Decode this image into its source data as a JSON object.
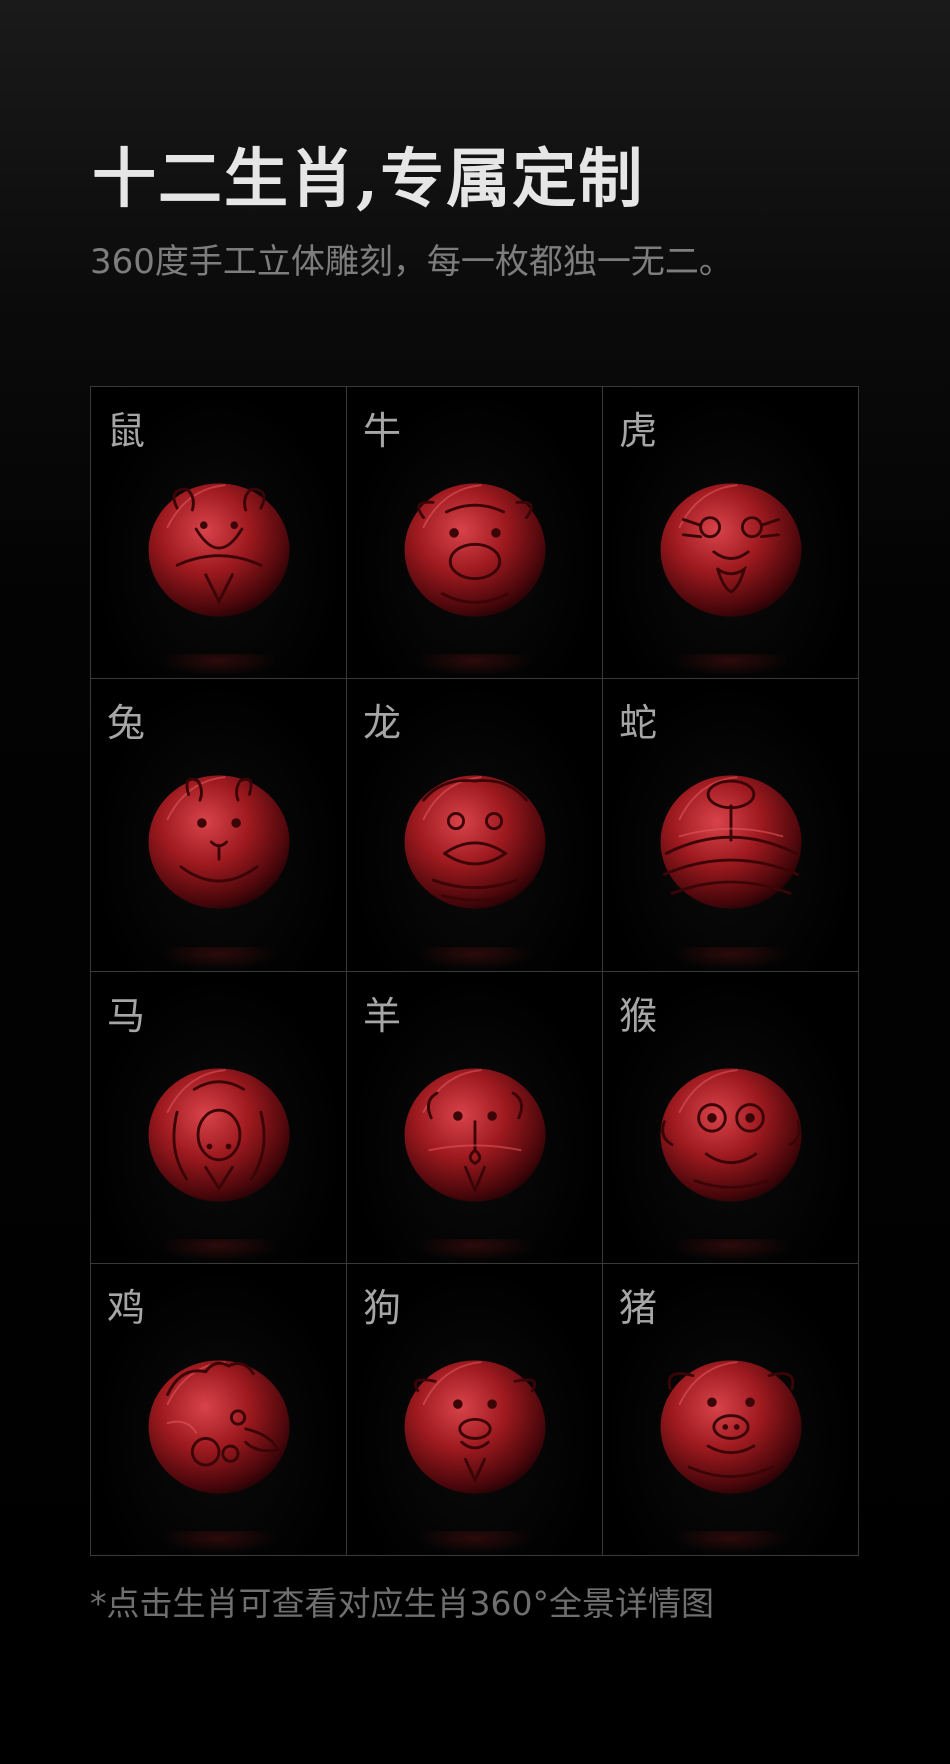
{
  "header": {
    "title": "十二生肖,专属定制",
    "subtitle": "360度手工立体雕刻，每一枚都独一无二。"
  },
  "zodiac": [
    {
      "label": "鼠",
      "icon": "rat-bead-icon"
    },
    {
      "label": "牛",
      "icon": "ox-bead-icon"
    },
    {
      "label": "虎",
      "icon": "tiger-bead-icon"
    },
    {
      "label": "兔",
      "icon": "rabbit-bead-icon"
    },
    {
      "label": "龙",
      "icon": "dragon-bead-icon"
    },
    {
      "label": "蛇",
      "icon": "snake-bead-icon"
    },
    {
      "label": "马",
      "icon": "horse-bead-icon"
    },
    {
      "label": "羊",
      "icon": "goat-bead-icon"
    },
    {
      "label": "猴",
      "icon": "monkey-bead-icon"
    },
    {
      "label": "鸡",
      "icon": "rooster-bead-icon"
    },
    {
      "label": "狗",
      "icon": "dog-bead-icon"
    },
    {
      "label": "猪",
      "icon": "pig-bead-icon"
    }
  ],
  "footnote": "*点击生肖可查看对应生肖360°全景详情图",
  "colors": {
    "background": "#000000",
    "title": "#e6e6e6",
    "subtitle": "#7d7d7d",
    "grid_line": "#3a3a3a",
    "bead_red": "#9e1a1f"
  }
}
